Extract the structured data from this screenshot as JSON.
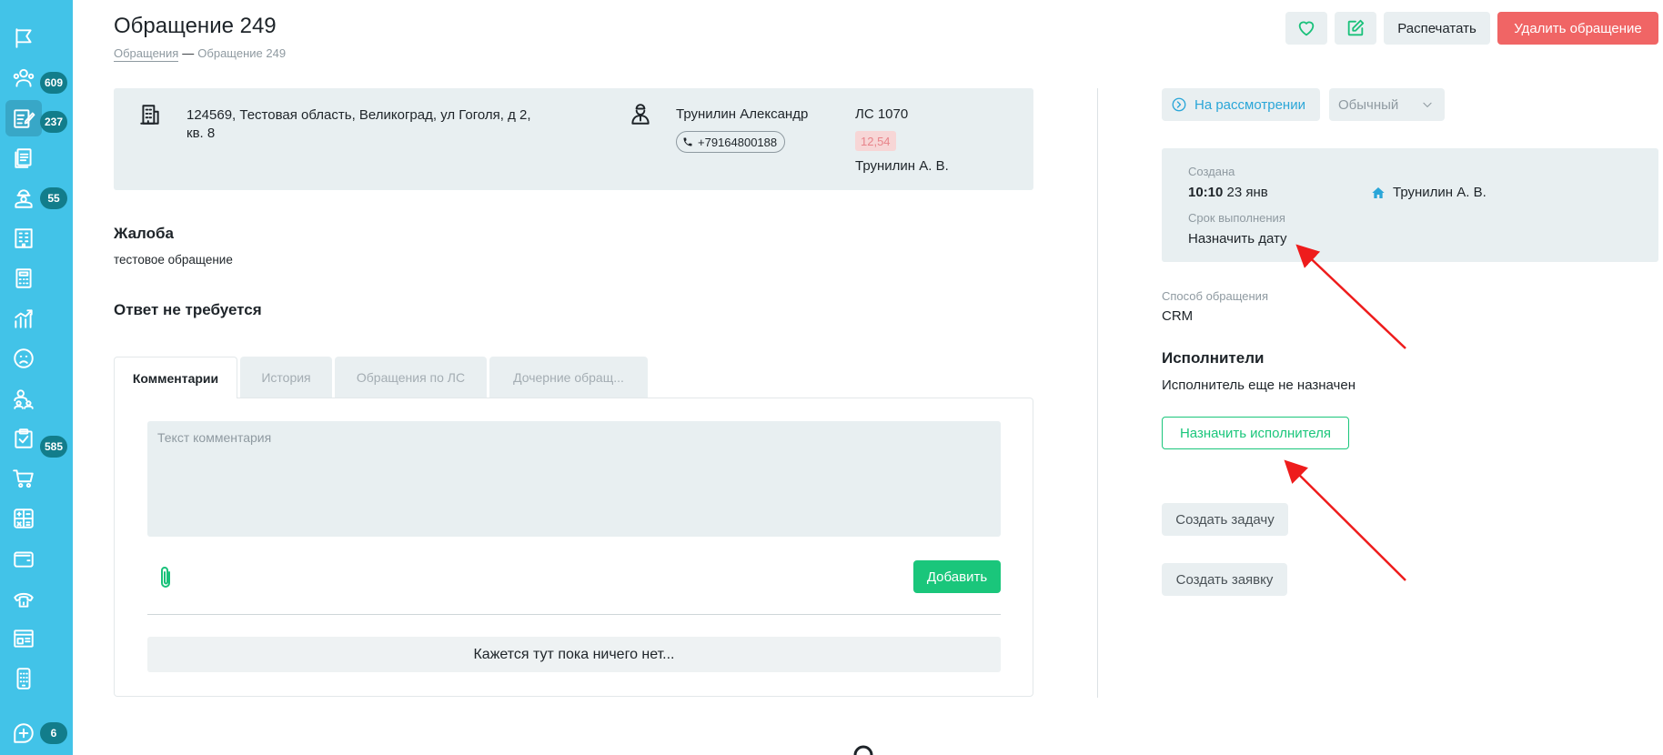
{
  "sidebar": {
    "items": [
      {
        "icon": "flag-icon"
      },
      {
        "icon": "users-icon",
        "badge": "609"
      },
      {
        "icon": "edit-document-icon",
        "badge": "237",
        "active": true
      },
      {
        "icon": "documents-icon"
      },
      {
        "icon": "worker-icon",
        "badge": "55"
      },
      {
        "icon": "building-icon"
      },
      {
        "icon": "calculator-icon"
      },
      {
        "icon": "chart-icon"
      },
      {
        "icon": "sad-face-icon"
      },
      {
        "icon": "team-icon"
      },
      {
        "icon": "clipboard-check-icon",
        "badge": "585"
      },
      {
        "icon": "cart-icon"
      },
      {
        "icon": "math-icon"
      },
      {
        "icon": "wallet-icon"
      },
      {
        "icon": "phone-icon"
      },
      {
        "icon": "dashboard-icon"
      },
      {
        "icon": "mobile-icon"
      },
      {
        "icon": "chat-add-icon",
        "badge": "6"
      }
    ]
  },
  "header": {
    "title": "Обращение 249",
    "breadcrumb": {
      "link": "Обращения",
      "separator": "—",
      "current": "Обращение 249"
    },
    "print_label": "Распечатать",
    "delete_label": "Удалить обращение"
  },
  "info": {
    "address": "124569, Тестовая область, Великоград, ул Гоголя, д 2, кв. 8",
    "resident_name": "Трунилин Александр",
    "phone": "+79164800188",
    "account": "ЛС 1070",
    "balance": "12,54",
    "owner": "Трунилин А. В."
  },
  "complaint": {
    "heading": "Жалоба",
    "text": "тестовое обращение",
    "reply_status": "Ответ не требуется"
  },
  "tabs": [
    {
      "label": "Комментарии"
    },
    {
      "label": "История"
    },
    {
      "label": "Обращения по ЛС"
    },
    {
      "label": "Дочерние обращ..."
    }
  ],
  "comments": {
    "placeholder": "Текст комментария",
    "add_label": "Добавить",
    "empty_text": "Кажется тут пока ничего нет..."
  },
  "right": {
    "status_label": "На рассмотрении",
    "priority_label": "Обычный",
    "created_label": "Создана",
    "created_time": "10:10",
    "created_date": "23 янв",
    "author": "Трунилин А. В.",
    "deadline_label": "Срок выполнения",
    "deadline_value": "Назначить дату",
    "channel_label": "Способ обращения",
    "channel_value": "CRM",
    "executors_heading": "Исполнители",
    "executors_empty": "Исполнитель еще не назначен",
    "assign_label": "Назначить исполнителя",
    "create_task_label": "Создать задачу",
    "create_request_label": "Создать заявку"
  },
  "colors": {
    "sidebar": "#42c3e8",
    "accent_green": "#1ac67b",
    "danger": "#f06565",
    "status_blue": "#2aa6d8",
    "annotation_arrow": "#ee1c1c"
  }
}
